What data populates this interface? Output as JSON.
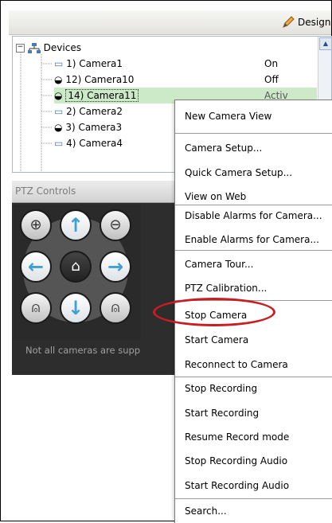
{
  "toolbar": {
    "design_label": "Design"
  },
  "tree": {
    "root_label": "Devices",
    "items": [
      {
        "label": "1) Camera1",
        "status": "On"
      },
      {
        "label": "12) Camera10",
        "status": "Off"
      },
      {
        "label": "14) Camera11",
        "status": ""
      },
      {
        "label": "2) Camera2",
        "status": ""
      },
      {
        "label": "3) Camera3",
        "status": ""
      },
      {
        "label": "4) Camera4",
        "status": ""
      }
    ],
    "partial_status": "Activ"
  },
  "ptz": {
    "title": "PTZ Controls",
    "note": "Not all cameras are supp",
    "buttons": [
      {
        "name": "zoom-in-icon",
        "glyph": "⊕"
      },
      {
        "name": "arrow-up-icon",
        "glyph": "↑"
      },
      {
        "name": "zoom-out-icon",
        "glyph": "⊖"
      },
      {
        "name": "arrow-left-icon",
        "glyph": "←"
      },
      {
        "name": "home-icon",
        "glyph": "⌂"
      },
      {
        "name": "arrow-right-icon",
        "glyph": "→"
      },
      {
        "name": "lock-open-icon",
        "glyph": "⍝"
      },
      {
        "name": "arrow-down-icon",
        "glyph": "↓"
      },
      {
        "name": "lock-closed-icon",
        "glyph": "⍝"
      }
    ]
  },
  "context_menu": {
    "items": [
      "New Camera View",
      "Camera Setup...",
      "Quick Camera Setup...",
      "View on Web",
      "Disable Alarms for Camera...",
      "Enable Alarms for Camera...",
      "Camera Tour...",
      "PTZ Calibration...",
      "Stop Camera",
      "Start Camera",
      "Reconnect to Camera",
      "Stop Recording",
      "Start Recording",
      "Resume Record mode",
      "Stop Recording Audio",
      "Start Recording Audio",
      "Search..."
    ]
  },
  "colors": {
    "highlight_circle": "#c81e22",
    "ptz_background": "#2d2d2d",
    "arrow_blue": "#3fa0d6",
    "selected_row": "#cdeac8"
  }
}
